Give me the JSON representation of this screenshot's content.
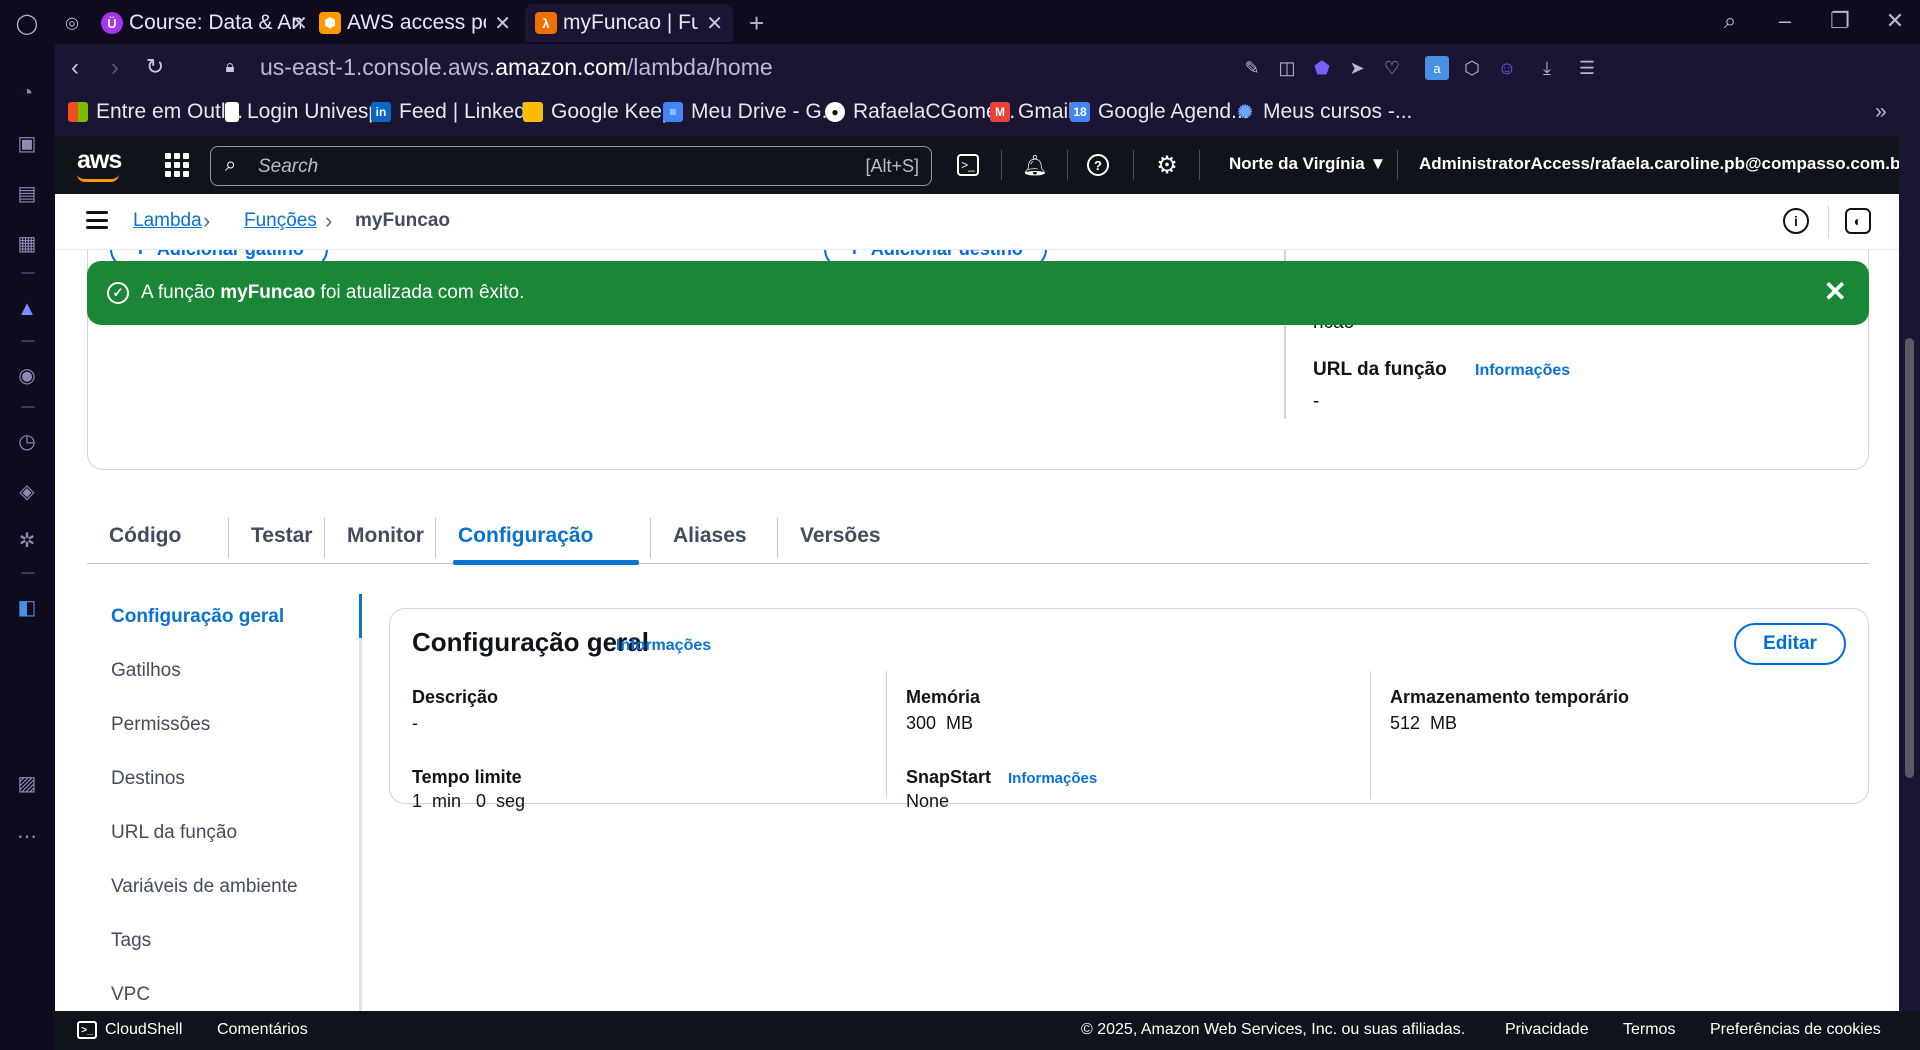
{
  "browser": {
    "tabs": [
      {
        "title": "Course: Data & Anal",
        "icon": "udemy-icon",
        "color": "#a435f0"
      },
      {
        "title": "AWS access portal",
        "icon": "aws-cube-icon",
        "color": "#ff9900"
      },
      {
        "title": "myFuncao | Funções",
        "icon": "lambda-icon",
        "color": "#ed7100"
      }
    ],
    "new_tab_label": "+",
    "url_prefix": "us-east-1.console.aws.",
    "url_domain": "amazon.com",
    "url_path": "/lambda/home",
    "bookmarks": [
      {
        "label": "Entre em Outl...",
        "icon": "microsoft-icon"
      },
      {
        "label": "Login Univesp",
        "icon": "page-icon"
      },
      {
        "label": "Feed | LinkedIn",
        "icon": "linkedin-icon"
      },
      {
        "label": "Google Keep",
        "icon": "keep-icon"
      },
      {
        "label": "Meu Drive - G...",
        "icon": "docs-icon"
      },
      {
        "label": "RafaelaCGome...",
        "icon": "github-icon"
      },
      {
        "label": "Gmail",
        "icon": "gmail-icon"
      },
      {
        "label": "Google Agend...",
        "icon": "calendar-icon"
      },
      {
        "label": "Meus cursos -...",
        "icon": "course-icon"
      }
    ]
  },
  "aws_header": {
    "logo": "aws",
    "search_placeholder": "Search",
    "search_shortcut": "[Alt+S]",
    "region": "Norte da Virgínia ▼",
    "account": "AdministratorAccess/rafaela.caroline.pb@compasso.com.br ▼"
  },
  "breadcrumb": {
    "items": [
      "Lambda",
      "Funções"
    ],
    "current": "myFuncao"
  },
  "flash": {
    "prefix": "A função ",
    "function_name": "myFuncao",
    "suffix": " foi atualizada com êxito."
  },
  "function_overview": {
    "add_trigger": "Adicionar gatilho",
    "add_destination": "Adicionar destino",
    "name_fragment": "ncao",
    "function_url_label": "URL da função",
    "function_url_info": "Informações",
    "function_url_value": "-"
  },
  "tabs": [
    "Código",
    "Testar",
    "Monitor",
    "Configuração",
    "Aliases",
    "Versões"
  ],
  "selected_tab": "Configuração",
  "config_nav": [
    "Configuração geral",
    "Gatilhos",
    "Permissões",
    "Destinos",
    "URL da função",
    "Variáveis de ambiente",
    "Tags",
    "VPC"
  ],
  "general_config": {
    "title": "Configuração geral",
    "info": "Informações",
    "edit": "Editar",
    "description_label": "Descrição",
    "description_value": "-",
    "timeout_label": "Tempo limite",
    "timeout_value": "1  min   0  seg",
    "memory_label": "Memória",
    "memory_value": "300  MB",
    "snapstart_label": "SnapStart",
    "snapstart_info": "Informações",
    "snapstart_value": "None",
    "storage_label": "Armazenamento temporário",
    "storage_value": "512  MB"
  },
  "footer": {
    "cloudshell": "CloudShell",
    "feedback": "Comentários",
    "copyright": "© 2025, Amazon Web Services, Inc. ou suas afiliadas.",
    "privacy": "Privacidade",
    "terms": "Termos",
    "cookies": "Preferências de cookies"
  },
  "colors": {
    "aws_nav": "#0f141a",
    "link_blue": "#0972d3",
    "success_green": "#1a8736",
    "browser_bg": "#0f0a1e"
  }
}
